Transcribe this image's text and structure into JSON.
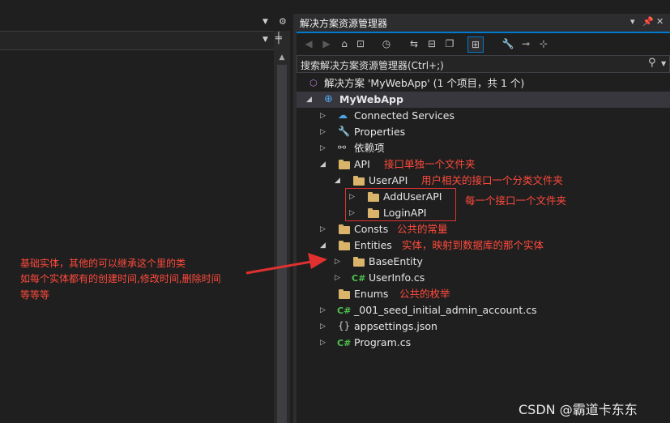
{
  "explorer": {
    "title": "解决方案资源管理器",
    "search_placeholder": "搜索解决方案资源管理器(Ctrl+;)",
    "solution_label": "解决方案 'MyWebApp' (1 个项目，共 1 个)",
    "project": "MyWebApp",
    "items": {
      "connected_services": "Connected Services",
      "properties": "Properties",
      "dependencies": "依赖项",
      "api": "API",
      "user_api": "UserAPI",
      "add_user_api": "AddUserAPI",
      "login_api": "LoginAPI",
      "consts": "Consts",
      "entities": "Entities",
      "base_entity": "BaseEntity",
      "user_info": "UserInfo.cs",
      "enums": "Enums",
      "seed": "_001_seed_initial_admin_account.cs",
      "appsettings": "appsettings.json",
      "program": "Program.cs"
    },
    "cs_glyph": "C#"
  },
  "annotations": {
    "api": "接口单独一个文件夹",
    "user_api": "用户相关的接口一个分类文件夹",
    "each_api": "每一个接口一个文件夹",
    "consts": "公共的常量",
    "entities": "实体，映射到数据库的那个实体",
    "enums": "公共的枚举",
    "base_entity_line1": "基础实体，其他的可以继承这个里的类",
    "base_entity_line2": "如每个实体都有的创建时间,修改时间,删除时间",
    "base_entity_line3": "等等等"
  },
  "watermark": "CSDN @霸道卡东东",
  "colors": {
    "accent": "#007acc",
    "annotation": "#ff4a3d",
    "folder": "#d9b46a",
    "csharp": "#4ec04e"
  }
}
